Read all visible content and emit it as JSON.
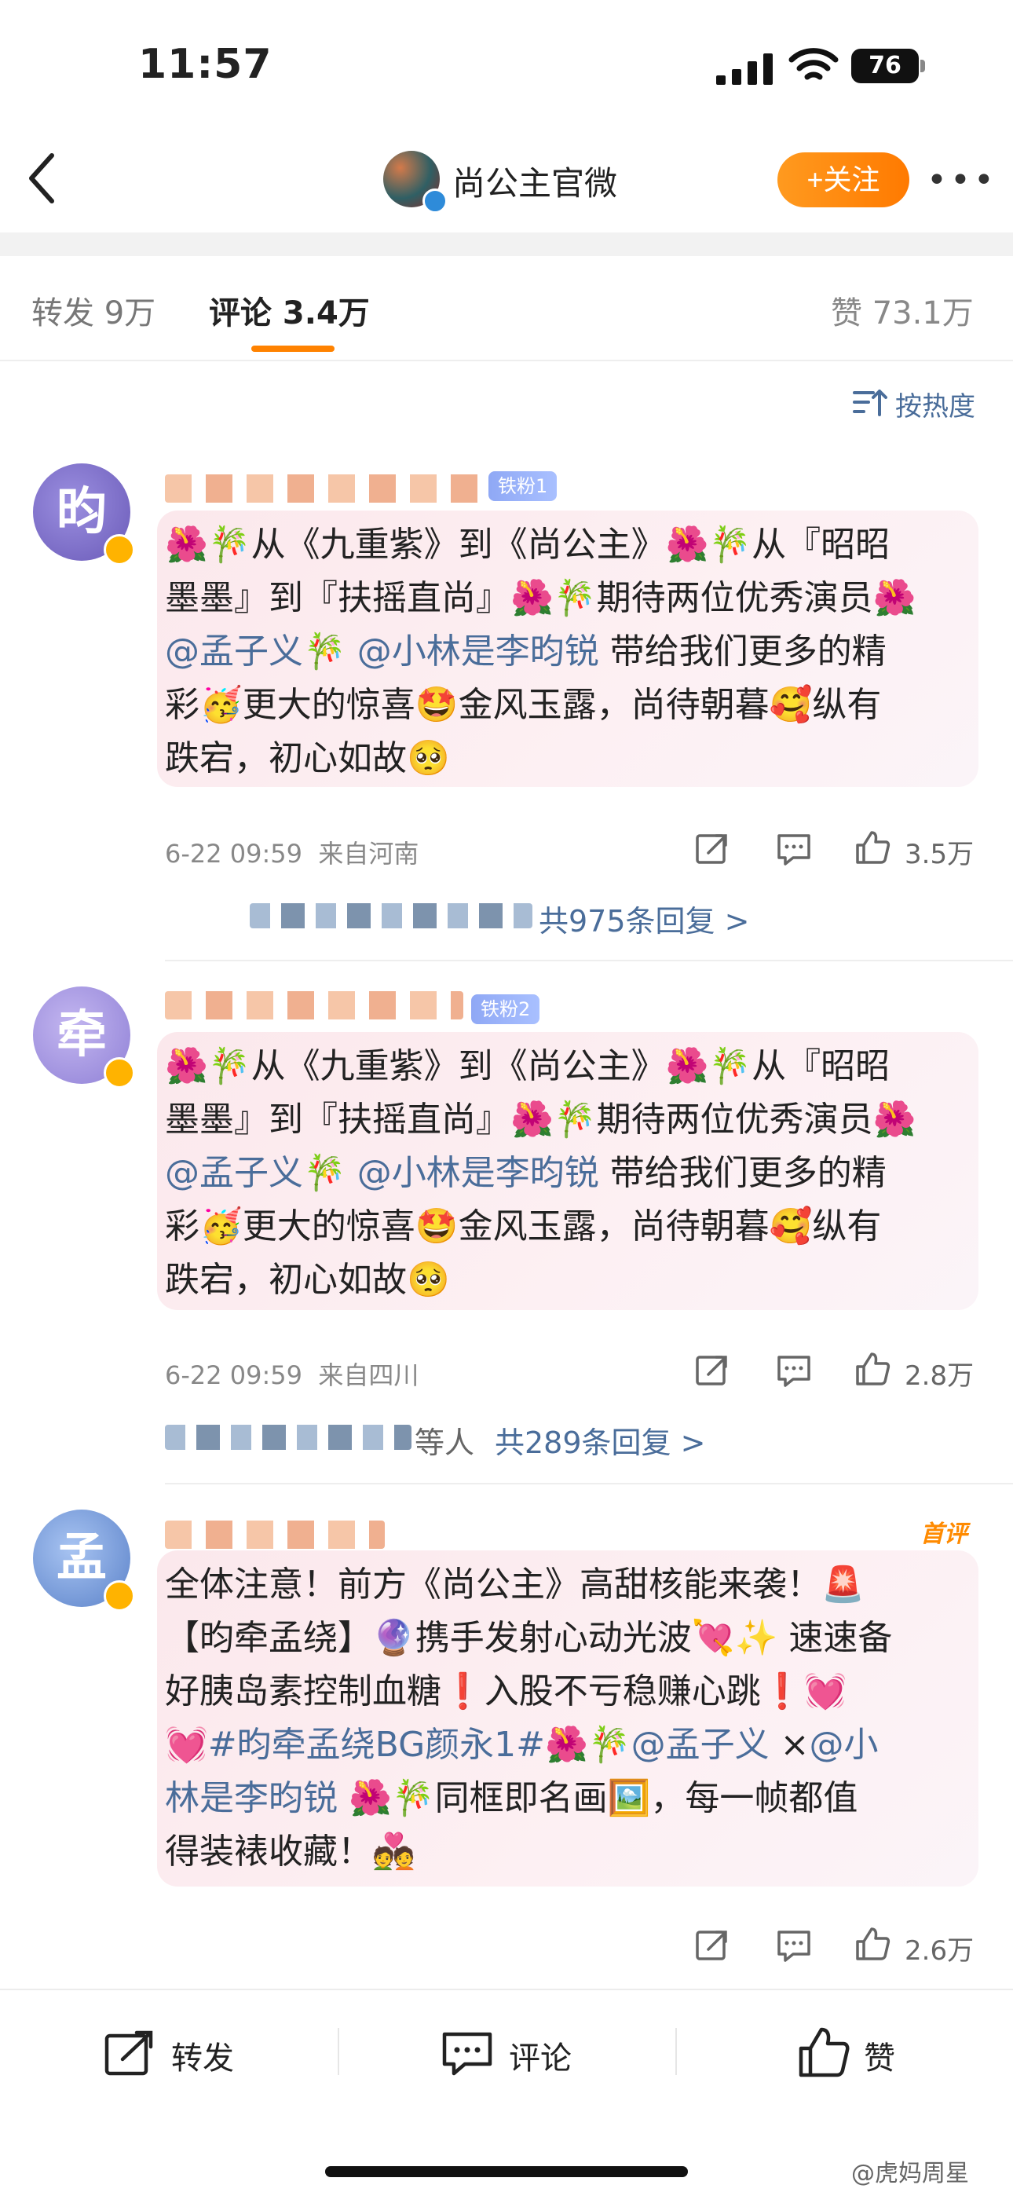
{
  "status_bar": {
    "time": "11:57",
    "battery": "76"
  },
  "header": {
    "title": "尚公主官微",
    "follow_label": "+关注",
    "more_label": "•••"
  },
  "tabs": {
    "forward": "转发 9万",
    "comment": "评论 3.4万",
    "like": "赞 73.1万"
  },
  "sort_label": "按热度",
  "comments": [
    {
      "avatar_char": "昀",
      "fan_badge": "铁粉1",
      "line1": "🌺🎋从《九重紫》到《尚公主》🌺🎋从『昭昭",
      "line2": "墨墨』到『扶摇直尚』🌺🎋期待两位优秀演员🌺",
      "mention1": "@孟子义",
      "mid": "🎋",
      "mention2": "@小林是李昀锐",
      "line3_tail": "带给我们更多的精",
      "line4": "彩🥳更大的惊喜🤩金风玉露，尚待朝暮🥰纵有",
      "line5": "跌宕，初心如故🥺",
      "time": "6-22 09:59",
      "location": "来自河南",
      "likes": "3.5万",
      "replies": "共975条回复 >"
    },
    {
      "avatar_char": "牵",
      "fan_badge": "铁粉2",
      "line1": "🌺🎋从《九重紫》到《尚公主》🌺🎋从『昭昭",
      "line2": "墨墨』到『扶摇直尚』🌺🎋期待两位优秀演员🌺",
      "mention1": "@孟子义",
      "mid": "🎋",
      "mention2": "@小林是李昀锐",
      "line3_tail": "带给我们更多的精",
      "line4": "彩🥳更大的惊喜🤩金风玉露，尚待朝暮🥰纵有",
      "line5": "跌宕，初心如故🥺",
      "time": "6-22 09:59",
      "location": "来自四川",
      "likes": "2.8万",
      "reply_prefix": "等人",
      "replies": "共289条回复 >"
    },
    {
      "avatar_char": "孟",
      "first_badge": "首评",
      "line1": "全体注意！前方《尚公主》高甜核能来袭！🚨",
      "line2": "【昀牵孟绕】🔮携手发射心动光波💘✨ 速速备",
      "line3": "好胰岛素控制血糖❗️入股不亏稳赚心跳❗️💓",
      "hashtag": "💓#昀牵孟绕BG颜永1#",
      "line4_mid": "🌺🎋",
      "mention1": "@孟子义",
      "line4_x": "×",
      "mention2a": "@小",
      "mention2b": "林是李昀锐",
      "line5_tail": "🌺🎋同框即名画🖼️，每一帧都值",
      "line6": "得装裱收藏！💑",
      "likes": "2.6万"
    }
  ],
  "bottom_bar": {
    "forward": "转发",
    "comment": "评论",
    "like": "赞"
  },
  "watermark": "@虎妈周星",
  "colors": {
    "accent": "#ff8200",
    "link": "#4a6d9a",
    "follow": "#ff7a00"
  }
}
